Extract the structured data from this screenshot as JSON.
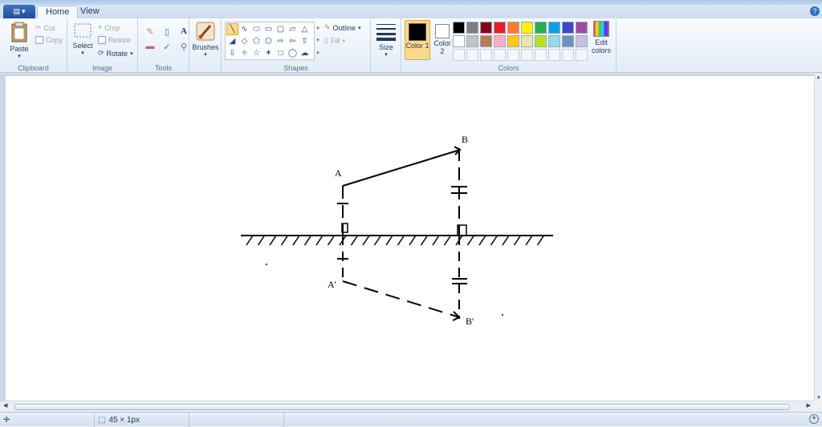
{
  "tabs": [
    {
      "label": "Home"
    },
    {
      "label": "View"
    }
  ],
  "help_label": "?",
  "ribbon": {
    "clipboard": {
      "paste": "Paste",
      "cut": "Cut",
      "copy": "Copy",
      "label": "Clipboard"
    },
    "image": {
      "select": "Select",
      "crop": "Crop",
      "resize": "Resize",
      "rotate": "Rotate",
      "label": "Image"
    },
    "tools": {
      "label": "Tools"
    },
    "brushes": {
      "label": "Brushes"
    },
    "shapes": {
      "outline": "Outline",
      "fill": "Fill",
      "label": "Shapes"
    },
    "size": {
      "label": "Size"
    },
    "colors": {
      "color1": "Color 1",
      "color2": "Color 2",
      "edit": "Edit colors",
      "label": "Colors",
      "palette_row1": [
        "#000000",
        "#7f7f7f",
        "#880015",
        "#ed1c24",
        "#ff7f27",
        "#fff200",
        "#22b14c",
        "#00a2e8",
        "#3f48cc",
        "#a349a4"
      ],
      "palette_row2": [
        "#ffffff",
        "#c3c3c3",
        "#b97a57",
        "#ffaec9",
        "#ffc90e",
        "#efe4b0",
        "#b5e61d",
        "#99d9ea",
        "#7092be",
        "#c8bfe7"
      ],
      "color1_value": "#000000",
      "color2_value": "#ffffff"
    }
  },
  "drawing": {
    "label_a": "A",
    "label_b": "B",
    "label_a_prime": "A'",
    "label_b_prime": "B'"
  },
  "status": {
    "selection_size": "45 × 1px"
  }
}
